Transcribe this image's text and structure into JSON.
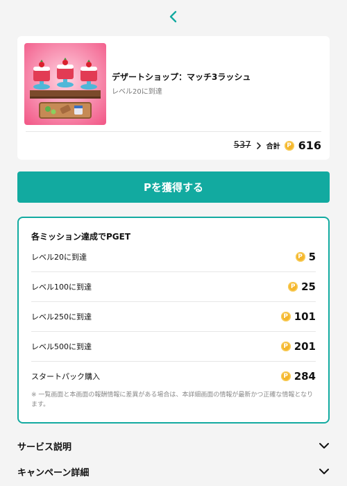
{
  "header": {
    "back_icon": "chevron-left-icon",
    "accent_color": "#12aaa0"
  },
  "offer": {
    "title": "デザートショップ：マッチ3ラッシュ",
    "condition": "レベル20に到達",
    "old_points": "537",
    "total_label": "合計",
    "total_points": "616",
    "coin_symbol": "P",
    "coin_color": "#f5b62b"
  },
  "cta": {
    "label": "Pを獲得する"
  },
  "missions": {
    "title": "各ミッション達成でPGET",
    "items": [
      {
        "label": "レベル20に到達",
        "points": "5"
      },
      {
        "label": "レベル100に到達",
        "points": "25"
      },
      {
        "label": "レベル250に到達",
        "points": "101"
      },
      {
        "label": "レベル500に到達",
        "points": "201"
      },
      {
        "label": "スタートパック購入",
        "points": "284"
      }
    ],
    "note": "※ 一覧画面と本画面の報酬情報に差異がある場合は、本詳細画面の情報が最新かつ正確な情報となります。"
  },
  "sections": [
    {
      "label": "サービス説明",
      "icon": "chevron-down-icon"
    },
    {
      "label": "キャンペーン詳細",
      "icon": "chevron-down-icon"
    }
  ]
}
